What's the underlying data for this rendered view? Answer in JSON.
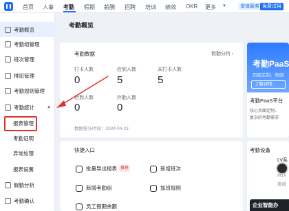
{
  "topnav": {
    "items": [
      "首页",
      "人事",
      "考勤",
      "假期",
      "薪酬",
      "招聘",
      "培训",
      "绩效",
      "OKR",
      "更多"
    ],
    "tag_service": "增值服务",
    "tag_free": "免费试用"
  },
  "sidebar": {
    "items": [
      "考勤概览",
      "考勤组管理",
      "班次管理",
      "排班管理",
      "考勤规则管理",
      "考勤统计",
      "假勤分析",
      "考勤确认"
    ],
    "subitems": [
      "报表管理",
      "考勤证明",
      "异常处理",
      "报表设置"
    ]
  },
  "page": {
    "title": "考勤概览"
  },
  "attendance": {
    "title": "考勤数据",
    "link": "假勤分析",
    "stats": [
      {
        "label": "打卡人数",
        "value": "0"
      },
      {
        "label": "应到人数",
        "value": "5"
      },
      {
        "label": "未打卡人数",
        "value": "5"
      },
      {
        "label": "迟到人数",
        "value": "0"
      },
      {
        "label": "外勤人数",
        "value": "0"
      }
    ],
    "stat_time": "数据统计时间：2024-04-23"
  },
  "quick": {
    "title": "快捷入口",
    "items": [
      "批量导出报表",
      "新增班次",
      "新增考勤组",
      "加班规则",
      "员工假期余额"
    ],
    "recommend": "推荐"
  },
  "promo": {
    "title": "考勤PaaS",
    "subtitle": "页面定制、规则",
    "button": "了解详情",
    "title2": "考勤PaaS平台",
    "desc1": "核心页面定制、",
    "desc2": "复杂的考勤需求"
  },
  "devices": {
    "title": "考勤设备",
    "device_name": "LV系",
    "device_model": "M1X",
    "device_status": "离线"
  },
  "enterprise": {
    "label": "企业智能办"
  },
  "colors": {
    "accent": "#1d6ff2",
    "highlight": "#e0322c"
  }
}
